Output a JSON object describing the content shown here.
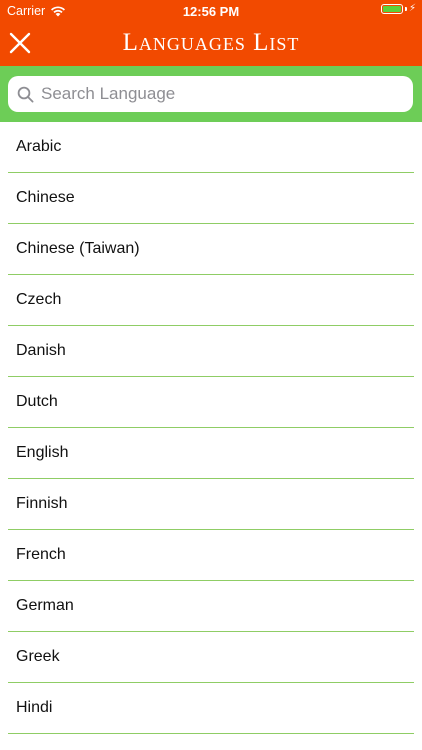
{
  "status_bar": {
    "carrier": "Carrier",
    "time": "12:56 PM"
  },
  "header": {
    "title": "Languages List",
    "close_icon": "close-icon"
  },
  "search": {
    "placeholder": "Search Language",
    "value": ""
  },
  "languages": [
    "Arabic",
    "Chinese",
    "Chinese (Taiwan)",
    "Czech",
    "Danish",
    "Dutch",
    "English",
    "Finnish",
    "French",
    "German",
    "Greek",
    "Hindi"
  ],
  "colors": {
    "header_orange": "#f24a00",
    "search_green": "#6dcd57",
    "divider_green": "#8fcd65",
    "battery_green": "#5cd13a"
  }
}
